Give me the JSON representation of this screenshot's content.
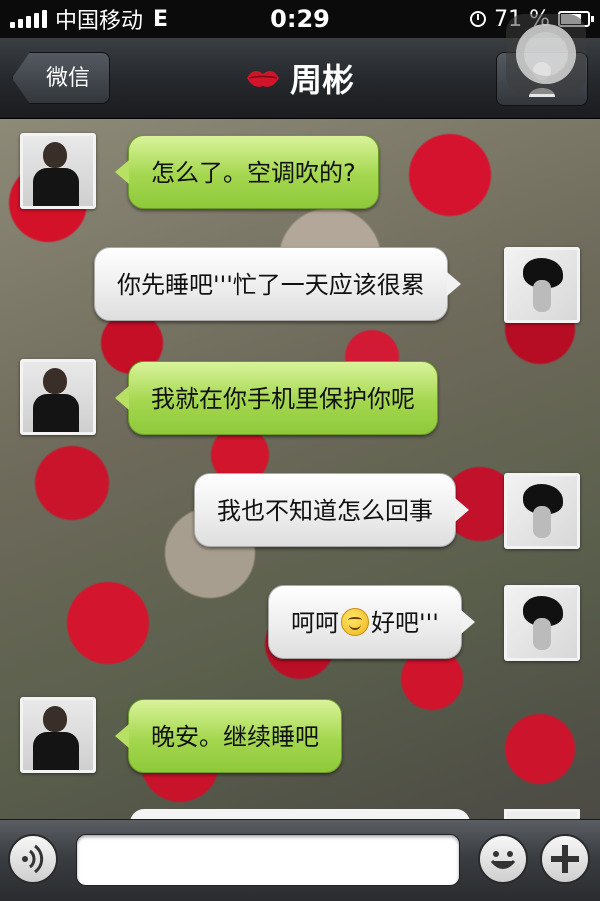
{
  "status_bar": {
    "carrier": "中国移动",
    "network": "E",
    "time": "0:29",
    "battery": "71 %",
    "signal_bars": 5
  },
  "nav": {
    "back_label": "微信",
    "title": "周彬",
    "title_icon": "lips-icon",
    "right_icon": "person-icon"
  },
  "messages": [
    {
      "side": "left",
      "sender": "friend",
      "text": "怎么了。空调吹的?"
    },
    {
      "side": "right",
      "sender": "me",
      "text": "你先睡吧'''忙了一天应该很累"
    },
    {
      "side": "left",
      "sender": "friend",
      "text": "我就在你手机里保护你呢"
    },
    {
      "side": "right",
      "sender": "me",
      "text": "我也不知道怎么回事"
    },
    {
      "side": "right",
      "sender": "me",
      "text_before": "呵呵",
      "emoji": "smile-emoji",
      "text_after": "好吧'''"
    },
    {
      "side": "left",
      "sender": "friend",
      "text": "晚安。继续睡吧"
    }
  ],
  "input_bar": {
    "voice_icon": "voice-icon",
    "input_value": "",
    "emoji_icon": "smiley-icon",
    "plus_icon": "plus-icon"
  },
  "colors": {
    "green_bubble": "#a4d74f",
    "white_bubble": "#f2f2f2",
    "nav_bar": "#26292d",
    "lips": "#d2142a"
  }
}
